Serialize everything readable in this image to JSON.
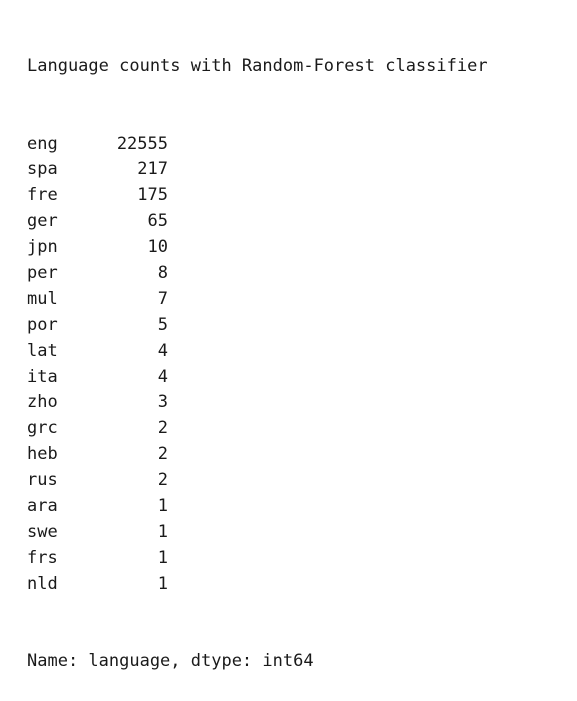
{
  "output": {
    "title": "Language counts with Random-Forest classifier",
    "rows": [
      {
        "lang": "eng",
        "count": "22555"
      },
      {
        "lang": "spa",
        "count": "217"
      },
      {
        "lang": "fre",
        "count": "175"
      },
      {
        "lang": "ger",
        "count": "65"
      },
      {
        "lang": "jpn",
        "count": "10"
      },
      {
        "lang": "per",
        "count": "8"
      },
      {
        "lang": "mul",
        "count": "7"
      },
      {
        "lang": "por",
        "count": "5"
      },
      {
        "lang": "lat",
        "count": "4"
      },
      {
        "lang": "ita",
        "count": "4"
      },
      {
        "lang": "zho",
        "count": "3"
      },
      {
        "lang": "grc",
        "count": "2"
      },
      {
        "lang": "heb",
        "count": "2"
      },
      {
        "lang": "rus",
        "count": "2"
      },
      {
        "lang": "ara",
        "count": "1"
      },
      {
        "lang": "swe",
        "count": "1"
      },
      {
        "lang": "frs",
        "count": "1"
      },
      {
        "lang": "nld",
        "count": "1"
      }
    ],
    "footer_partial": "Name: language, dtype: int64"
  }
}
